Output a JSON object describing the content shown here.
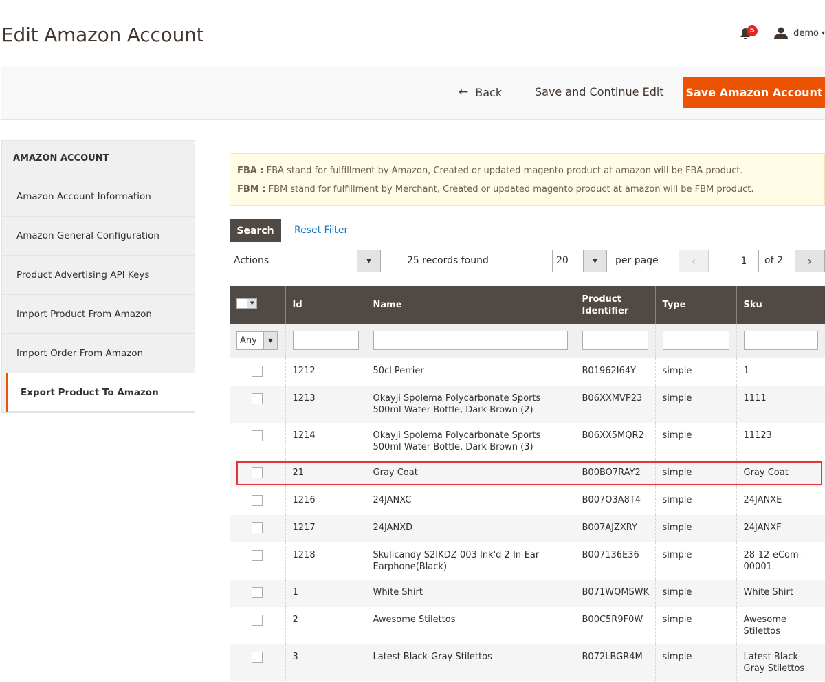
{
  "header": {
    "title": "Edit Amazon Account",
    "notifications_count": "5",
    "user_name": "demo"
  },
  "actions": {
    "back_label": "Back",
    "continue_label": "Save and Continue Edit",
    "save_label": "Save Amazon Account"
  },
  "sidebar": {
    "title": "AMAZON ACCOUNT",
    "items": [
      {
        "label": "Amazon Account Information"
      },
      {
        "label": "Amazon General Configuration"
      },
      {
        "label": "Product Advertising API Keys"
      },
      {
        "label": "Import Product From Amazon"
      },
      {
        "label": "Import Order From Amazon"
      },
      {
        "label": "Export Product To Amazon"
      }
    ],
    "active_index": 5
  },
  "notice": {
    "fba_label": "FBA :",
    "fba_text": "FBA stand for fulfillment by Amazon, Created or updated magento product at amazon will be FBA product.",
    "fbm_label": "FBM :",
    "fbm_text": "FBM stand for fulfillment by Merchant, Created or updated magento product at amazon will be FBM product."
  },
  "grid_controls": {
    "search_label": "Search",
    "reset_label": "Reset Filter",
    "actions_value": "Actions",
    "records_text": "25 records found",
    "per_page_value": "20",
    "per_page_label": "per page",
    "current_page": "1",
    "of_pages": "of 2"
  },
  "table": {
    "columns": [
      "Id",
      "Name",
      "Product Identifier",
      "Type",
      "Sku"
    ],
    "any_filter": "Any",
    "rows": [
      {
        "id": "1212",
        "name": "50cl Perrier",
        "identifier": "B01962I64Y",
        "type": "simple",
        "sku": "1"
      },
      {
        "id": "1213",
        "name": "Okayji Spolema Polycarbonate Sports 500ml Water Bottle, Dark Brown (2)",
        "identifier": "B06XXMVP23",
        "type": "simple",
        "sku": "1111"
      },
      {
        "id": "1214",
        "name": "Okayji Spolema Polycarbonate Sports 500ml Water Bottle, Dark Brown (3)",
        "identifier": "B06XX5MQR2",
        "type": "simple",
        "sku": "11123"
      },
      {
        "id": "21",
        "name": "Gray Coat",
        "identifier": "B00BO7RAY2",
        "type": "simple",
        "sku": "Gray Coat"
      },
      {
        "id": "1216",
        "name": "24JANXC",
        "identifier": "B007O3A8T4",
        "type": "simple",
        "sku": "24JANXE"
      },
      {
        "id": "1217",
        "name": "24JANXD",
        "identifier": "B007AJZXRY",
        "type": "simple",
        "sku": "24JANXF"
      },
      {
        "id": "1218",
        "name": "Skullcandy S2IKDZ-003 Ink'd 2 In-Ear Earphone(Black)",
        "identifier": "B007136E36",
        "type": "simple",
        "sku": "28-12-eCom-00001"
      },
      {
        "id": "1",
        "name": "White Shirt",
        "identifier": "B071WQMSWK",
        "type": "simple",
        "sku": "White Shirt"
      },
      {
        "id": "2",
        "name": "Awesome Stilettos",
        "identifier": "B00C5R9F0W",
        "type": "simple",
        "sku": "Awesome Stilettos"
      },
      {
        "id": "3",
        "name": "Latest Black-Gray Stilettos",
        "identifier": "B072LBGR4M",
        "type": "simple",
        "sku": "Latest Black-Gray Stilettos"
      }
    ]
  },
  "colors": {
    "accent": "#eb5202",
    "header_bg": "#514943",
    "highlight": "#e2343d",
    "link": "#1979c3"
  }
}
